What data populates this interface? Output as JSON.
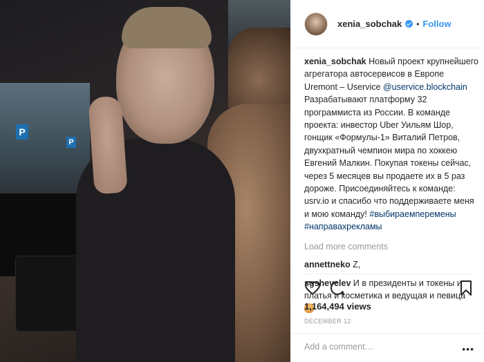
{
  "post": {
    "username": "xenia_sobchak",
    "dot": "•",
    "follow_label": "Follow",
    "caption": {
      "user": "xenia_sobchak",
      "text_1": "Новый проект крупнейшего агрегатора автосервисов в Европе Uremont – Uservice",
      "mention": "@uservice.blockchain",
      "text_2": "Разрабатывают платформу 32 программиста из России. В команде проекта: инвестор Uber Уильям Шор, гонщик «Формулы-1» Виталий Петров, двухкратный чемпион мира по хоккею Евгений Малкин. Покупая токены сейчас, через 5 месяцев вы продаете их в 5 раз дороже. Присоединяйтесь к команде: usrv.io и спасибо что поддерживаете меня и мою команду!",
      "tags": "#выбираемперемены #направахрекламы"
    },
    "load_more": "Load more comments",
    "comments": [
      {
        "user": "annettneko",
        "text": "Z,"
      },
      {
        "user": "sgshevelev",
        "text": "И в президенты и токены и платья и косметика и ведущая и певица"
      }
    ],
    "views": "1,164,494 views",
    "date": "DECEMBER 12",
    "add_comment_placeholder": "Add a comment…",
    "more_options": "•••"
  },
  "media": {
    "parking_sign": "P"
  },
  "colors": {
    "link": "#3897f0",
    "hashtag": "#003569",
    "muted": "#999999"
  }
}
